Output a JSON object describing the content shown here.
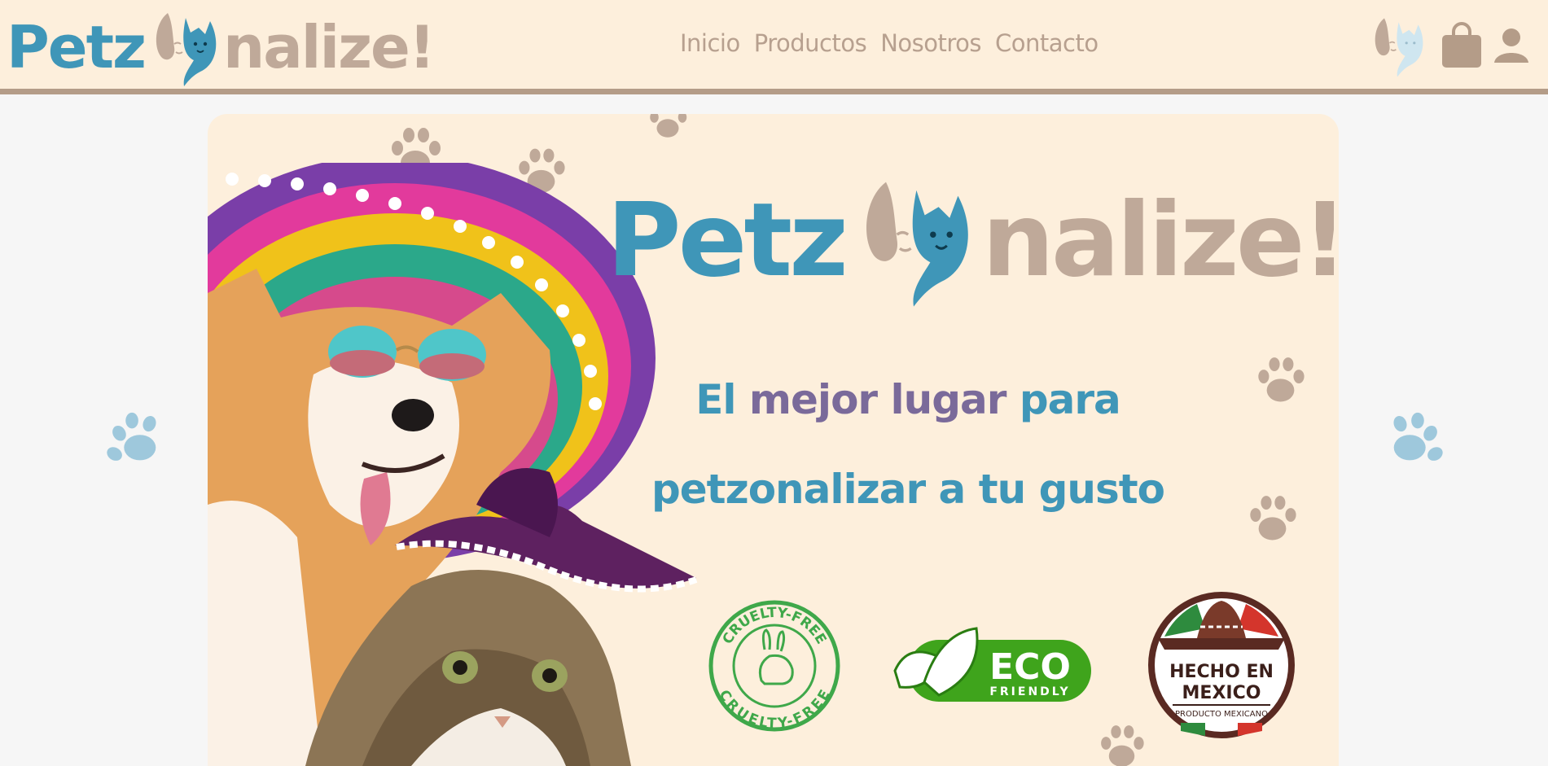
{
  "brand": {
    "name_left": "Petz",
    "name_right": "nalize!",
    "colors": {
      "blue": "#3f96b8",
      "tan": "#bfa999",
      "header_bg": "#fdefdc",
      "header_border": "#b49c88"
    }
  },
  "nav": {
    "items": [
      {
        "label": "Inicio"
      },
      {
        "label": "Productos"
      },
      {
        "label": "Nosotros"
      },
      {
        "label": "Contacto"
      }
    ]
  },
  "tools": {
    "icons": [
      "theme-toggle-icon",
      "shopping-bag-icon",
      "user-icon"
    ]
  },
  "hero": {
    "logo_left": "Petz",
    "logo_right": "nalize!",
    "tagline_line1": {
      "w1": "El",
      "w2": "mejor lugar",
      "w3": "para"
    },
    "tagline_line2": "petzonalizar a tu gusto",
    "badges": {
      "cruelty_top": "CRUELTY-FREE",
      "cruelty_bottom": "CRUELTY-FREE",
      "eco_main": "ECO",
      "eco_sub": "FRIENDLY",
      "mexico_line1": "HECHO EN",
      "mexico_line2": "MEXICO",
      "mexico_sub": "PRODUCTO MEXICANO"
    }
  }
}
